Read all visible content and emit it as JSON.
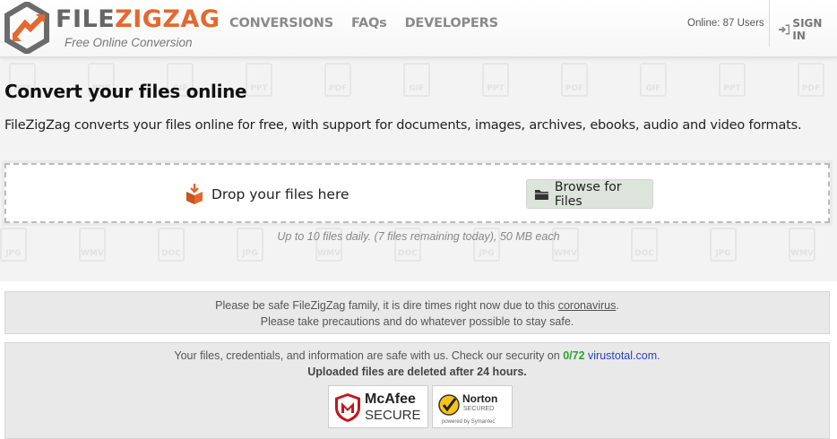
{
  "header": {
    "logo_file": "FILE",
    "logo_zigzag": "ZIGZAG",
    "tagline": "Free Online Conversion",
    "nav": [
      {
        "label": "CONVERSIONS"
      },
      {
        "label": "FAQs"
      },
      {
        "label": "DEVELOPERS"
      }
    ],
    "online": "Online: 87 Users",
    "signin": "SIGN IN"
  },
  "main": {
    "title": "Convert your files online",
    "subtitle": "FileZigZag converts your files online for free, with support for documents, images, archives, ebooks, audio and video formats.",
    "drop_text": "Drop your files here",
    "browse_label": "Browse for Files",
    "limits": "Up to 10 files daily. (7 files remaining today), 50 MB each"
  },
  "background_icons": [
    "PPT",
    "PDF",
    "GIF",
    "PPT",
    "PDF",
    "GIF",
    "PPT",
    "PDF",
    "GIF",
    "PPT",
    "PDF",
    "JPG",
    "WMV",
    "DOC",
    "JPG",
    "WMV",
    "DOC",
    "JPG",
    "WMV",
    "DOC",
    "JPG",
    "WMV"
  ],
  "notice": {
    "line1_prefix": "Please be safe FileZigZag family, it is dire times right now due to this ",
    "line1_link": "coronavirus",
    "line1_suffix": ".",
    "line2": "Please take precautions and do whatever possible to stay safe."
  },
  "security": {
    "line1_prefix": "Your files, credentials, and information are safe with us. Check our security on ",
    "score": "0/72",
    "vt_link": "virustotal.com",
    "line1_suffix": ".",
    "line2": "Uploaded files are deleted after 24 hours.",
    "mcafee_brand": "McAfee",
    "mcafee_secure": "SECURE",
    "norton_brand": "Norton",
    "norton_secured": "SECURED",
    "norton_powered": "powered by Symantec"
  },
  "colors": {
    "brand_orange": "#e2692f",
    "brand_gray": "#666666",
    "score_green": "#2aa52a",
    "link_blue": "#2a3fbf"
  }
}
